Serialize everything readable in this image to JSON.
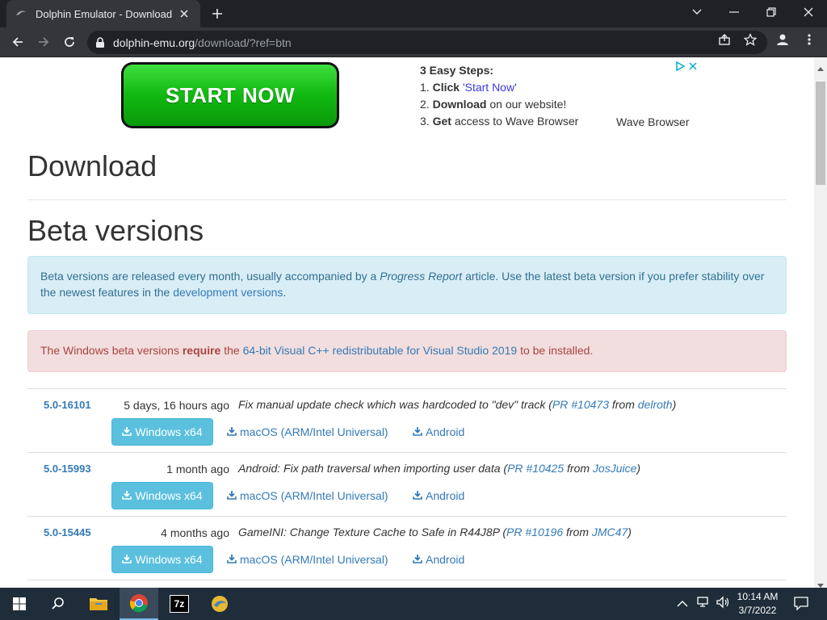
{
  "browser": {
    "tab_title": "Dolphin Emulator - Download",
    "url_host": "dolphin-emu.org",
    "url_path": "/download/?ref=btn"
  },
  "ad": {
    "button_label": "START NOW",
    "steps_heading": "3 Easy Steps:",
    "step1_num": "1.",
    "step1_bold": "Click",
    "step1_link": "'Start Now'",
    "step2_num": "2.",
    "step2_bold": "Download",
    "step2_rest": "on our website!",
    "step3_num": "3.",
    "step3_bold": "Get",
    "step3_rest": "access to Wave Browser",
    "brand": "Wave Browser"
  },
  "page": {
    "title": "Download",
    "section_title": "Beta versions",
    "info_text_1": "Beta versions are released every month, usually accompanied by a",
    "info_italic": "Progress Report",
    "info_text_2": "article. Use the latest beta version if you prefer stability over the newest features in the",
    "info_link": "development versions",
    "info_end": ".",
    "warn_text_1": "The Windows beta versions",
    "warn_bold": "require",
    "warn_text_2": "the",
    "warn_link": "64-bit Visual C++ redistributable for Visual Studio 2019",
    "warn_text_3": "to be installed."
  },
  "versions": [
    {
      "version": "5.0-16101",
      "when": "5 days, 16 hours ago",
      "desc": "Fix manual update check which was hardcoded to \"dev\" track",
      "pr": "PR #10473",
      "from": "from",
      "author": "delroth"
    },
    {
      "version": "5.0-15993",
      "when": "1 month ago",
      "desc": "Android: Fix path traversal when importing user data",
      "pr": "PR #10425",
      "from": "from",
      "author": "JosJuice"
    },
    {
      "version": "5.0-15445",
      "when": "4 months ago",
      "desc": "GameINI: Change Texture Cache to Safe in R44J8P",
      "pr": "PR #10196",
      "from": "from",
      "author": "JMC47"
    }
  ],
  "downloads": {
    "windows": "Windows x64",
    "macos": "macOS (ARM/Intel Universal)",
    "android": "Android"
  },
  "taskbar": {
    "time": "10:14 AM",
    "date": "3/7/2022",
    "sevenzip_label": "7z"
  },
  "colors": {
    "accent": "#337ab7",
    "info_bg": "#d9edf7",
    "danger_bg": "#f2dede",
    "button_bg": "#5bc0de"
  }
}
